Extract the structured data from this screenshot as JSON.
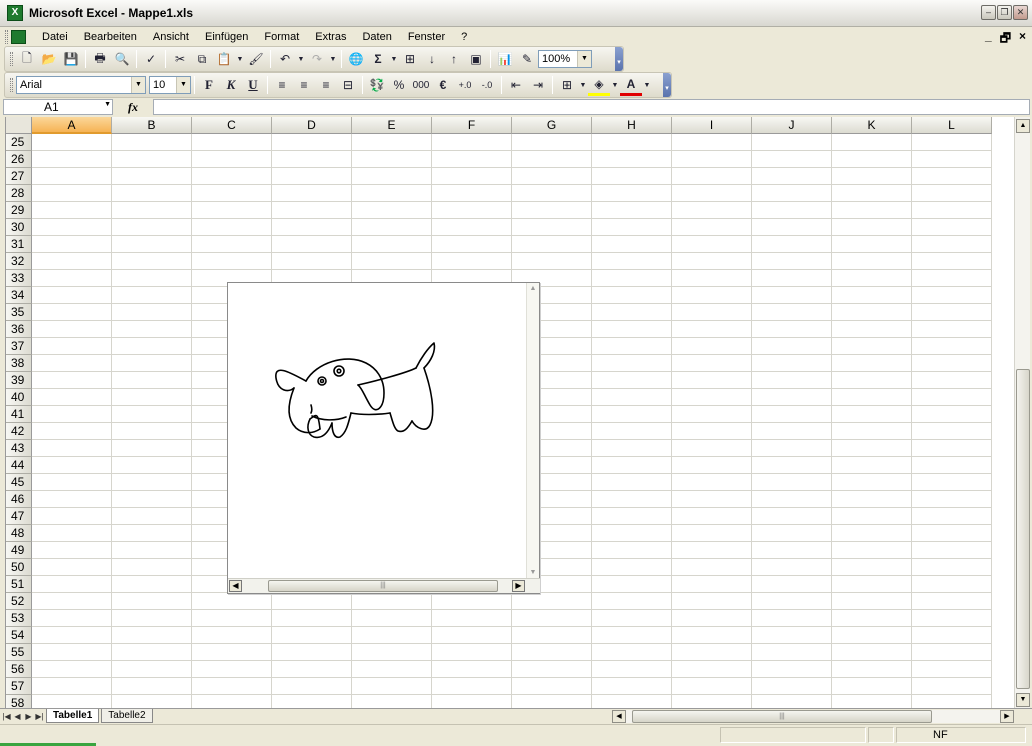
{
  "window": {
    "title": "Microsoft Excel - Mappe1.xls"
  },
  "menu": {
    "items": [
      "Datei",
      "Bearbeiten",
      "Ansicht",
      "Einfügen",
      "Format",
      "Extras",
      "Daten",
      "Fenster",
      "?"
    ],
    "doc_controls": [
      "_",
      "🗗",
      "×"
    ]
  },
  "toolbar_standard": {
    "zoom": "100%"
  },
  "toolbar_format": {
    "font": "Arial",
    "size": "10",
    "bold": "F",
    "italic": "K",
    "underline": "U",
    "percent": "%",
    "thousands": "000",
    "euro": "€"
  },
  "formula_bar": {
    "name_box": "A1",
    "fx": "fx"
  },
  "grid": {
    "columns": [
      "A",
      "B",
      "C",
      "D",
      "E",
      "F",
      "G",
      "H",
      "I",
      "J",
      "K",
      "L"
    ],
    "active_column": "A",
    "rows": [
      "25",
      "26",
      "27",
      "28",
      "29",
      "30",
      "31",
      "32",
      "33",
      "34",
      "35",
      "36",
      "37",
      "38",
      "39",
      "40",
      "41",
      "42",
      "43",
      "44",
      "45",
      "46",
      "47",
      "48",
      "49",
      "50",
      "51",
      "52",
      "53",
      "54",
      "55",
      "56",
      "57",
      "58"
    ]
  },
  "sheets": {
    "tabs": [
      "Tabelle1",
      "Tabelle2"
    ],
    "active": "Tabelle1"
  },
  "status": {
    "mode_indicator": "NF"
  },
  "colors": {
    "active_header": "#f6b355",
    "gridline": "#d6d5cd",
    "progress": "#39a43f"
  }
}
